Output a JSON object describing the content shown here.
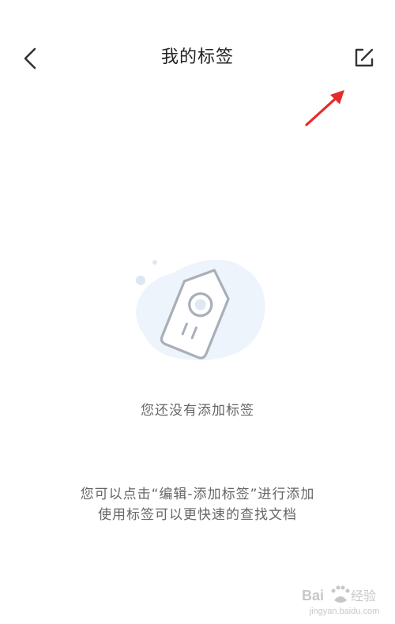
{
  "header": {
    "title": "我的标签",
    "back_icon": "chevron-left-icon",
    "edit_icon": "edit-square-icon"
  },
  "annotation": {
    "icon": "red-arrow-icon",
    "color": "#e52b2b"
  },
  "empty_state": {
    "illustration_icon": "tag-icon",
    "title": "您还没有添加标签"
  },
  "hint": {
    "line1": "您可以点击“编辑-添加标签”进行添加",
    "line2": "使用标签可以更快速的查找文档"
  },
  "watermark": {
    "logo_text": "Baidu经验",
    "domain": "jingyan.baidu.com"
  },
  "colors": {
    "text_primary": "#222222",
    "text_secondary": "#666666",
    "icon": "#333333",
    "illustration_bg": "#eef4fb",
    "illustration_stroke": "#a8afb8"
  }
}
